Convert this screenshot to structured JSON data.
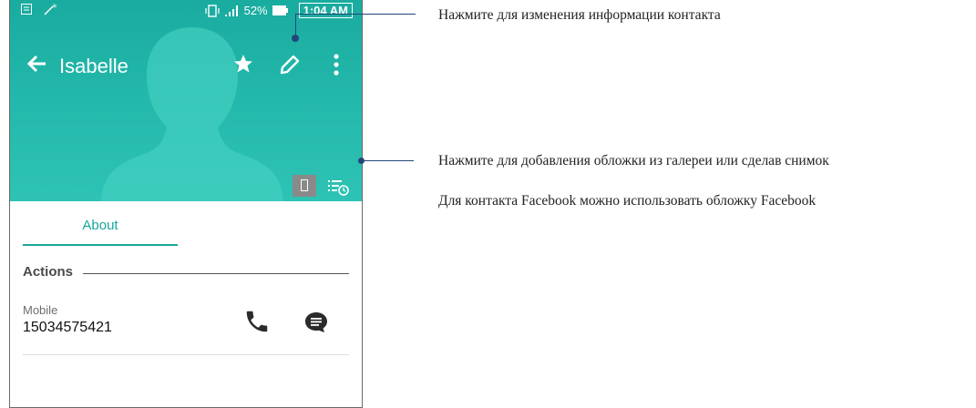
{
  "status_bar": {
    "battery_percent": "52%",
    "time": "1:04 AM"
  },
  "app_bar": {
    "contact_name": "Isabelle"
  },
  "tabs": {
    "about": "About"
  },
  "sections": {
    "actions_heading": "Actions"
  },
  "phone_entry": {
    "label": "Mobile",
    "number": "15034575421"
  },
  "callouts": {
    "edit_contact": "Нажмите для изменения информации контакта",
    "cover_from_gallery": "Нажмите для добавления обложки из галереи или сделав снимок",
    "facebook_cover": "Для контакта Facebook можно использовать обложку Facebook"
  },
  "colors": {
    "accent": "#1aa69b",
    "callout": "#22467a"
  },
  "icons": [
    "back-arrow-icon",
    "star-icon",
    "edit-icon",
    "more-vert-icon",
    "cover-photo-icon",
    "list-clock-icon",
    "phone-icon",
    "message-icon"
  ]
}
